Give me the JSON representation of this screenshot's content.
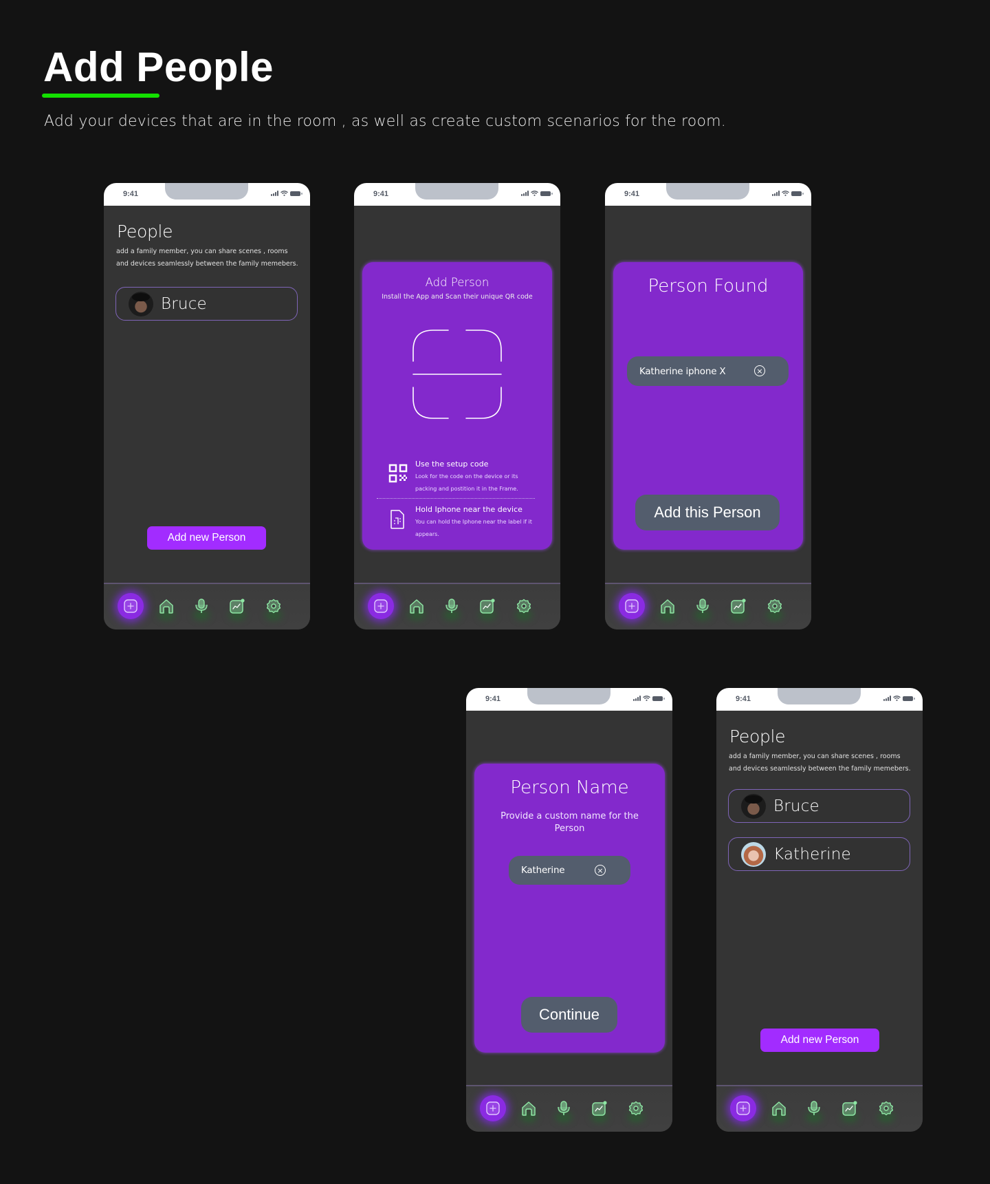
{
  "header": {
    "title": "Add People",
    "accent_color": "#13e000",
    "description": "Add  your devices that are in the room , as well as create custom scenarios for the room."
  },
  "status_bar": {
    "time": "9:41"
  },
  "colors": {
    "primary_button": "#a22cff",
    "card_purple": "#8329cc",
    "field_slate": "#535d6d",
    "nav_icon_green": "#8ee6a4",
    "background": "#131313",
    "phone_body": "#343434"
  },
  "nav": {
    "items": [
      {
        "id": "add",
        "icon": "plus-square-icon",
        "active": true
      },
      {
        "id": "home",
        "icon": "home-icon",
        "active": false
      },
      {
        "id": "voice",
        "icon": "microphone-icon",
        "active": false
      },
      {
        "id": "stats",
        "icon": "chart-icon",
        "active": false
      },
      {
        "id": "settings",
        "icon": "gear-icon",
        "active": false
      }
    ]
  },
  "screens": {
    "people_initial": {
      "title": "People",
      "subtitle": "add a family member, you can share scenes , rooms and devices seamlessly between the family memebers.",
      "people": [
        {
          "name": "Bruce",
          "avatar": "bruce"
        }
      ],
      "button_label": "Add new Person"
    },
    "add_person": {
      "title": "Add Person",
      "subtitle": "Install the App and Scan their unique QR code",
      "options": [
        {
          "icon": "qr-code-icon",
          "title": "Use the setup code",
          "description": "Look for the code on the device or its packing and postition it in the Frame."
        },
        {
          "icon": "nfc-tag-icon",
          "title": "Hold Iphone near the device",
          "description": "You can hold the Iphone near the label if it appears."
        }
      ]
    },
    "person_found": {
      "title": "Person Found",
      "device_value": "Katherine iphone X",
      "button_label": "Add this Person"
    },
    "person_name": {
      "title": "Person Name",
      "subtitle": "Provide a custom name for the Person",
      "name_value": "Katherine",
      "button_label": "Continue"
    },
    "people_final": {
      "title": "People",
      "subtitle": "add a family member, you can share scenes , rooms and devices seamlessly between the family memebers.",
      "people": [
        {
          "name": "Bruce",
          "avatar": "bruce"
        },
        {
          "name": "Katherine",
          "avatar": "katherine"
        }
      ],
      "button_label": "Add new Person"
    }
  }
}
